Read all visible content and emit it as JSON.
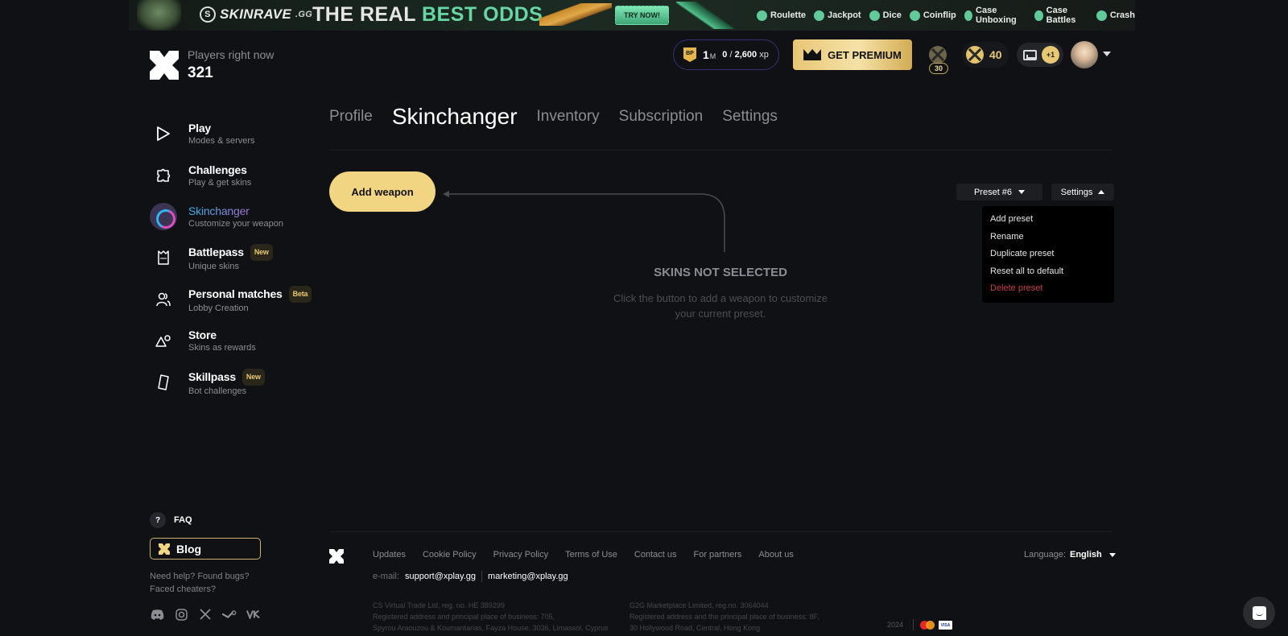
{
  "banner": {
    "brand": "SKINRAVE",
    "brand_suffix": ".GG",
    "slogan_white": "THE REAL ",
    "slogan_green": "BEST ODDS",
    "cta": "TRY NOW!",
    "games": [
      "Roulette",
      "Jackpot",
      "Dice",
      "Coinflip",
      "Case Unboxing",
      "Case Battles",
      "Crash"
    ]
  },
  "header": {
    "players_label": "Players right now",
    "players_count": "321",
    "battlepass": {
      "badge": "BP",
      "level": "1",
      "level_unit": "M",
      "xp_current": "0",
      "xp_total": "2,600",
      "xp_unit": "xp"
    },
    "premium_label": "GET PREMIUM",
    "level_badge": "30",
    "coins": "40",
    "inbox_count": "+1"
  },
  "sidebar": {
    "items": [
      {
        "title": "Play",
        "subtitle": "Modes & servers",
        "tag": null,
        "icon": "play-icon"
      },
      {
        "title": "Challenges",
        "subtitle": "Play & get skins",
        "tag": null,
        "icon": "puzzle-icon"
      },
      {
        "title": "Skinchanger",
        "subtitle": "Customize your weapon",
        "tag": null,
        "icon": "skinchanger-icon",
        "active": true
      },
      {
        "title": "Battlepass",
        "subtitle": "Unique skins",
        "tag": "New",
        "icon": "battlepass-icon"
      },
      {
        "title": "Personal matches",
        "subtitle": "Lobby Creation",
        "tag": "Beta",
        "icon": "users-icon"
      },
      {
        "title": "Store",
        "subtitle": "Skins as rewards",
        "tag": null,
        "icon": "shapes-icon"
      },
      {
        "title": "Skillpass",
        "subtitle": "Bot challenges",
        "tag": "New",
        "icon": "ticket-icon"
      }
    ],
    "faq_label": "FAQ",
    "faq_icon_glyph": "?",
    "blog_label": "Blog",
    "help_line1": "Need help? Found bugs?",
    "help_line2": "Faced cheaters?",
    "socials": [
      "discord",
      "instagram",
      "x",
      "steam",
      "vk"
    ]
  },
  "tabs": [
    {
      "label": "Profile",
      "active": false
    },
    {
      "label": "Skinchanger",
      "active": true
    },
    {
      "label": "Inventory",
      "active": false
    },
    {
      "label": "Subscription",
      "active": false
    },
    {
      "label": "Settings",
      "active": false
    }
  ],
  "main": {
    "add_weapon_label": "Add weapon",
    "empty_title": "SKINS NOT SELECTED",
    "empty_subtitle": "Click the button to add a weapon to customize your current preset.",
    "preset_label": "Preset #6",
    "settings_label": "Settings",
    "settings_menu": [
      {
        "label": "Add preset",
        "danger": false
      },
      {
        "label": "Rename",
        "danger": false
      },
      {
        "label": "Duplicate preset",
        "danger": false
      },
      {
        "label": "Reset all to default",
        "danger": false
      },
      {
        "label": "Delete preset",
        "danger": true
      }
    ]
  },
  "footer": {
    "links": [
      "Updates",
      "Cookie Policy",
      "Privacy Policy",
      "Terms of Use",
      "Contact us",
      "For partners",
      "About us"
    ],
    "email_label": "e-mail:",
    "emails": [
      "support@xplay.gg",
      "marketing@xplay.gg"
    ],
    "legal_left": [
      "CS Virtual Trade Ltd, reg. no. HE 389299",
      "Registered address and principal place of business: 705,",
      "Spyrou Araouzou & Koumantarias, Fayza House, 3036, Limassol, Cyprus"
    ],
    "legal_right": [
      "G2G Marketplace Limited, reg.no. 3064044",
      "Registered address and the principal place of business: 8F,",
      "30 Hollywood Road, Central, Hong Kong"
    ],
    "year": "2024",
    "payment_visa": "VISA",
    "language_label": "Language:",
    "language_value": "English"
  },
  "colors": {
    "background": "#101114",
    "accent_gold": "#f2d582",
    "danger": "#c2404a",
    "muted_text": "#8b8e94"
  }
}
